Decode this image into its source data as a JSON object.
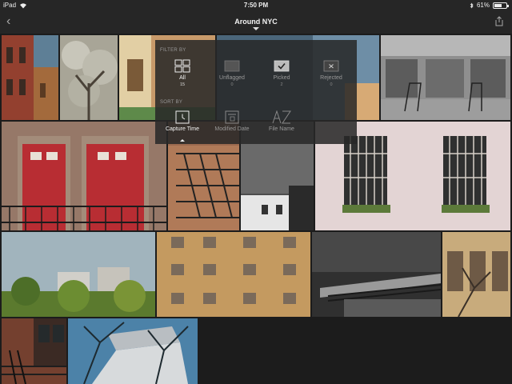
{
  "status_bar": {
    "device": "iPad",
    "time": "7:50 PM",
    "battery": "61%",
    "battery_level": 0.61
  },
  "nav": {
    "title": "Around NYC"
  },
  "filter_panel": {
    "filter_by_label": "FILTER BY",
    "sort_by_label": "SORT BY",
    "filters": [
      {
        "label": "All",
        "count": "15",
        "selected": true,
        "icon": "grid-icon"
      },
      {
        "label": "Unflagged",
        "count": "0",
        "selected": false,
        "icon": "unflagged-icon"
      },
      {
        "label": "Picked",
        "count": "2",
        "selected": false,
        "icon": "picked-flag-icon"
      },
      {
        "label": "Rejected",
        "count": "0",
        "selected": false,
        "icon": "rejected-flag-icon"
      }
    ],
    "sorts": [
      {
        "label": "Capture Time",
        "selected": true,
        "icon": "clock-icon"
      },
      {
        "label": "Modified Date",
        "selected": false,
        "icon": "calendar-icon"
      },
      {
        "label": "File Name",
        "selected": false,
        "icon": "az-icon"
      }
    ]
  },
  "photos": [
    {
      "name": "photo-brick-building",
      "color": "#8a3a2e"
    },
    {
      "name": "photo-tree-blossom",
      "color": "#9c998e"
    },
    {
      "name": "photo-house-facade",
      "color": "#b58a60"
    },
    {
      "name": "photo-blue-wall",
      "color": "#4f6c83"
    },
    {
      "name": "photo-bw-garage",
      "color": "#8c8c8c"
    },
    {
      "name": "photo-red-doors",
      "color": "#8f6e5a"
    },
    {
      "name": "photo-fire-escape",
      "color": "#8c6249"
    },
    {
      "name": "photo-bw-rooftop",
      "color": "#4a4a4a"
    },
    {
      "name": "photo-pink-windows",
      "color": "#dfcfcf"
    },
    {
      "name": "photo-trees-skyline",
      "color": "#7c8b86"
    },
    {
      "name": "photo-tan-apartments",
      "color": "#c1955a"
    },
    {
      "name": "photo-bw-train",
      "color": "#2b2b2b"
    },
    {
      "name": "photo-yellow-facade",
      "color": "#c3a676"
    },
    {
      "name": "photo-brick-stoop",
      "color": "#6a3d30"
    },
    {
      "name": "photo-white-house-tree",
      "color": "#3d6e93"
    }
  ]
}
